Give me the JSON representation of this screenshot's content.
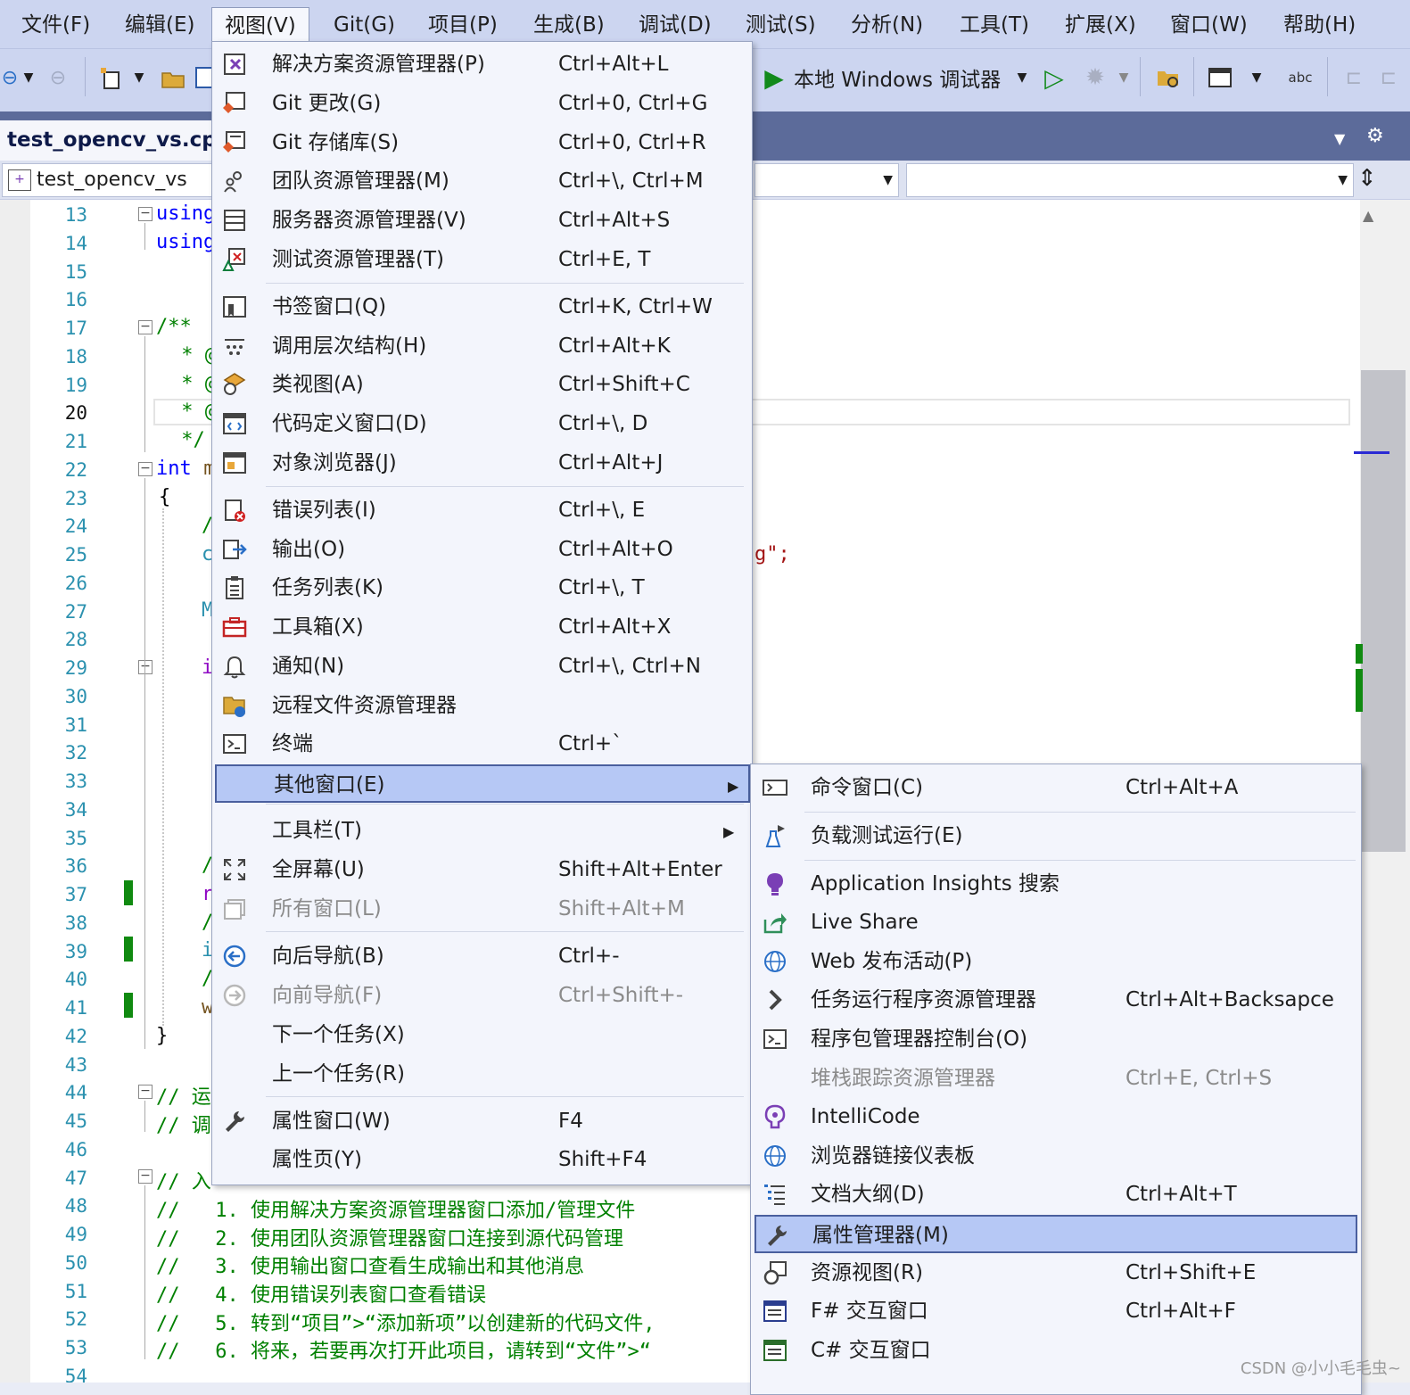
{
  "menubar": {
    "items": [
      "文件(F)",
      "编辑(E)",
      "视图(V)",
      "Git(G)",
      "项目(P)",
      "生成(B)",
      "调试(D)",
      "测试(S)",
      "分析(N)",
      "工具(T)",
      "扩展(X)",
      "窗口(W)",
      "帮助(H)"
    ]
  },
  "toolbar": {
    "debug_target": "本地 Windows 调试器"
  },
  "editor": {
    "doc_tab": "test_opencv_vs.cpp",
    "project_combo": "test_opencv_vs",
    "line_numbers": [
      "13",
      "14",
      "15",
      "16",
      "17",
      "18",
      "19",
      "20",
      "21",
      "22",
      "23",
      "24",
      "25",
      "26",
      "27",
      "28",
      "29",
      "30",
      "31",
      "32",
      "33",
      "34",
      "35",
      "36",
      "37",
      "38",
      "39",
      "40",
      "41",
      "42",
      "43",
      "44",
      "45",
      "46",
      "47",
      "48",
      "49",
      "50",
      "51",
      "52",
      "53",
      "54"
    ],
    "current_line": "20",
    "code_fragments": {
      "l13": "using",
      "l14": "using",
      "l17": "/**",
      "l18": " * @",
      "l19": " * @",
      "l20": " * @",
      "l21": " */",
      "l22_kw": "int",
      "l22_rest": " m",
      "l23": "{",
      "l24": "/",
      "l25a": "c",
      "l25b": "g\";",
      "l27": "M",
      "l29": "i",
      "l36": "/",
      "l37": "r",
      "l38": "/",
      "l39": "i",
      "l40": "/",
      "l41": "w",
      "l42": "}",
      "l44": "// 运",
      "l45": "// 调",
      "l47": "// 入",
      "l48": "//   1. 使用解决方案资源管理器窗口添加/管理文件",
      "l49": "//   2. 使用团队资源管理器窗口连接到源代码管理",
      "l50": "//   3. 使用输出窗口查看生成输出和其他消息",
      "l51": "//   4. 使用错误列表窗口查看错误",
      "l52": "//   5. 转到“项目”>“添加新项”以创建新的代码文件,",
      "l53": "//   6. 将来，若要再次打开此项目，请转到“文件”>“"
    }
  },
  "view_menu": {
    "items": [
      {
        "icon": "solution-explorer-icon",
        "label": "解决方案资源管理器(P)",
        "shortcut": "Ctrl+Alt+L"
      },
      {
        "icon": "git-changes-icon",
        "label": "Git 更改(G)",
        "shortcut": "Ctrl+0, Ctrl+G"
      },
      {
        "icon": "git-repository-icon",
        "label": "Git 存储库(S)",
        "shortcut": "Ctrl+0, Ctrl+R"
      },
      {
        "icon": "team-explorer-icon",
        "label": "团队资源管理器(M)",
        "shortcut": "Ctrl+\\, Ctrl+M"
      },
      {
        "icon": "server-explorer-icon",
        "label": "服务器资源管理器(V)",
        "shortcut": "Ctrl+Alt+S"
      },
      {
        "icon": "test-explorer-icon",
        "label": "测试资源管理器(T)",
        "shortcut": "Ctrl+E, T"
      },
      {
        "icon": "bookmark-window-icon",
        "label": "书签窗口(Q)",
        "shortcut": "Ctrl+K, Ctrl+W"
      },
      {
        "icon": "call-hierarchy-icon",
        "label": "调用层次结构(H)",
        "shortcut": "Ctrl+Alt+K"
      },
      {
        "icon": "class-view-icon",
        "label": "类视图(A)",
        "shortcut": "Ctrl+Shift+C"
      },
      {
        "icon": "code-definition-icon",
        "label": "代码定义窗口(D)",
        "shortcut": "Ctrl+\\, D"
      },
      {
        "icon": "object-browser-icon",
        "label": "对象浏览器(J)",
        "shortcut": "Ctrl+Alt+J"
      },
      {
        "icon": "error-list-icon",
        "label": "错误列表(I)",
        "shortcut": "Ctrl+\\, E"
      },
      {
        "icon": "output-icon",
        "label": "输出(O)",
        "shortcut": "Ctrl+Alt+O"
      },
      {
        "icon": "task-list-icon",
        "label": "任务列表(K)",
        "shortcut": "Ctrl+\\, T"
      },
      {
        "icon": "toolbox-icon",
        "label": "工具箱(X)",
        "shortcut": "Ctrl+Alt+X"
      },
      {
        "icon": "notification-bell-icon",
        "label": "通知(N)",
        "shortcut": "Ctrl+\\, Ctrl+N"
      },
      {
        "icon": "remote-file-explorer-icon",
        "label": "远程文件资源管理器",
        "shortcut": ""
      },
      {
        "icon": "terminal-icon",
        "label": "终端",
        "shortcut": "Ctrl+`"
      },
      {
        "icon": "",
        "label": "其他窗口(E)",
        "shortcut": ""
      },
      {
        "icon": "",
        "label": "工具栏(T)",
        "shortcut": ""
      },
      {
        "icon": "fullscreen-icon",
        "label": "全屏幕(U)",
        "shortcut": "Shift+Alt+Enter"
      },
      {
        "icon": "all-windows-icon",
        "label": "所有窗口(L)",
        "shortcut": "Shift+Alt+M"
      },
      {
        "icon": "navigate-back-icon",
        "label": "向后导航(B)",
        "shortcut": "Ctrl+-"
      },
      {
        "icon": "navigate-forward-icon",
        "label": "向前导航(F)",
        "shortcut": "Ctrl+Shift+-"
      },
      {
        "icon": "",
        "label": "下一个任务(X)",
        "shortcut": ""
      },
      {
        "icon": "",
        "label": "上一个任务(R)",
        "shortcut": ""
      },
      {
        "icon": "wrench-icon",
        "label": "属性窗口(W)",
        "shortcut": "F4"
      },
      {
        "icon": "",
        "label": "属性页(Y)",
        "shortcut": "Shift+F4"
      }
    ]
  },
  "other_windows_menu": {
    "items": [
      {
        "icon": "command-window-icon",
        "label": "命令窗口(C)",
        "shortcut": "Ctrl+Alt+A"
      },
      {
        "icon": "load-test-icon",
        "label": "负载测试运行(E)",
        "shortcut": ""
      },
      {
        "icon": "app-insights-icon",
        "label": "Application Insights 搜索",
        "shortcut": ""
      },
      {
        "icon": "live-share-icon",
        "label": "Live Share",
        "shortcut": ""
      },
      {
        "icon": "web-publish-icon",
        "label": "Web 发布活动(P)",
        "shortcut": ""
      },
      {
        "icon": "task-runner-icon",
        "label": "任务运行程序资源管理器",
        "shortcut": "Ctrl+Alt+Backsapce"
      },
      {
        "icon": "package-console-icon",
        "label": "程序包管理器控制台(O)",
        "shortcut": ""
      },
      {
        "icon": "",
        "label": "堆栈跟踪资源管理器",
        "shortcut": "Ctrl+E, Ctrl+S"
      },
      {
        "icon": "intellicode-icon",
        "label": "IntelliCode",
        "shortcut": ""
      },
      {
        "icon": "browser-link-icon",
        "label": "浏览器链接仪表板",
        "shortcut": ""
      },
      {
        "icon": "document-outline-icon",
        "label": "文档大纲(D)",
        "shortcut": "Ctrl+Alt+T"
      },
      {
        "icon": "property-manager-icon",
        "label": "属性管理器(M)",
        "shortcut": ""
      },
      {
        "icon": "resource-view-icon",
        "label": "资源视图(R)",
        "shortcut": "Ctrl+Shift+E"
      },
      {
        "icon": "fsharp-interactive-icon",
        "label": "F# 交互窗口",
        "shortcut": "Ctrl+Alt+F"
      },
      {
        "icon": "csharp-interactive-icon",
        "label": "C# 交互窗口",
        "shortcut": ""
      }
    ]
  },
  "watermark": "CSDN @小小毛毛虫~"
}
